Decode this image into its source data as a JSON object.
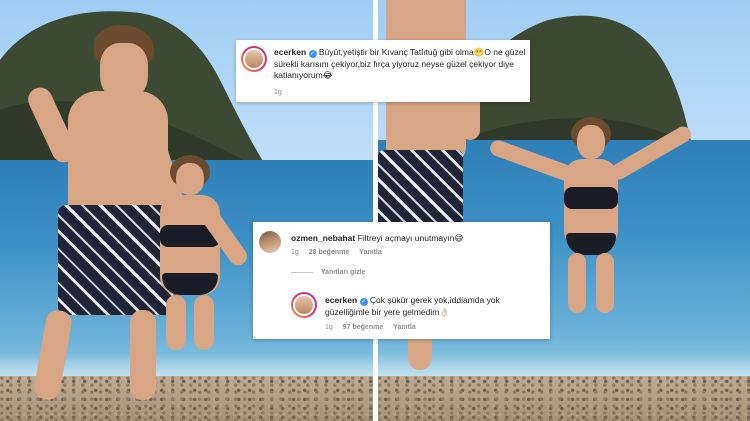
{
  "comments": [
    {
      "username": "ecerken",
      "verified": true,
      "text": "Büyüt,yetiştir bir Kıvanç Tatlıtuğ gibi olma😬O ne güzel sürekli karısını çekiyor,biz fırça yiyoruz neyse güzel çekiyor diye katlanıyorum😂",
      "time": "1g"
    },
    {
      "username": "ozmen_nebahat",
      "verified": false,
      "text": "Filtreyi açmayı unutmayın😄",
      "time": "1g",
      "likes": "28 beğenme",
      "reply_label": "Yanıtla",
      "hide_replies_label": "Yanıtları gizle",
      "reply": {
        "username": "ecerken",
        "verified": true,
        "text": "Çok şükür gerek yok,iddiamda yok güzelliğimle bir yere gelmedim👌🏻",
        "time": "1g",
        "likes": "97 beğenme",
        "reply_label": "Yanıtla"
      }
    }
  ],
  "colors": {
    "verified_badge": "#3897f0",
    "username_text": "#262626",
    "secondary_text": "#8e8e8e",
    "card_background": "#ffffff"
  }
}
